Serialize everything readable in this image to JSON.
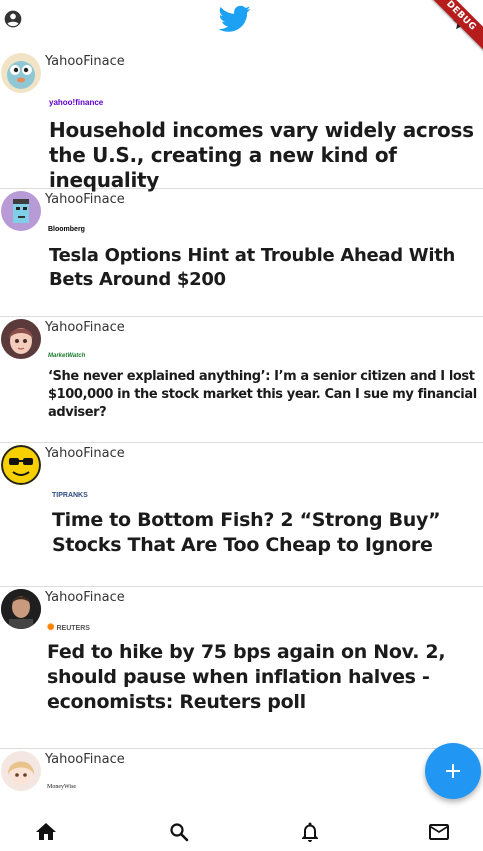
{
  "app": {
    "debug_label": "DEBUG"
  },
  "posts": [
    {
      "username": "YahooFinace",
      "source": "yahoo!finance",
      "headline": "Household incomes vary widely across the U.S., creating a new kind of inequality"
    },
    {
      "username": "YahooFinace",
      "source": "Bloomberg",
      "headline": "Tesla Options Hint at Trouble Ahead With Bets Around $200"
    },
    {
      "username": "YahooFinace",
      "source": "MarketWatch",
      "headline": "‘She never explained anything’: I’m a senior citizen and I lost $100,000 in the stock market this year. Can I sue my financial adviser?"
    },
    {
      "username": "YahooFinace",
      "source": "TIPRANKS",
      "headline": "Time to Bottom Fish? 2 “Strong Buy” Stocks That Are Too Cheap to Ignore"
    },
    {
      "username": "YahooFinace",
      "source": "REUTERS",
      "headline": "Fed to hike by 75 bps again on Nov. 2, should pause when inflation halves - economists: Reuters poll"
    },
    {
      "username": "YahooFinace",
      "source": "MoneyWise",
      "headline": ""
    }
  ],
  "icons": {
    "profile": "account-circle-icon",
    "logo": "twitter-bird-icon",
    "star": "star-icon",
    "fab": "add-icon",
    "nav": [
      "home-icon",
      "search-icon",
      "notifications-icon",
      "mail-icon"
    ]
  },
  "colors": {
    "accent": "#1DA1F2",
    "fab": "#2196F3",
    "debug": "#B71C1C",
    "yahoo": "#6001D2",
    "tipranks": "#2E4A7D",
    "reuters": "#FF8000"
  }
}
